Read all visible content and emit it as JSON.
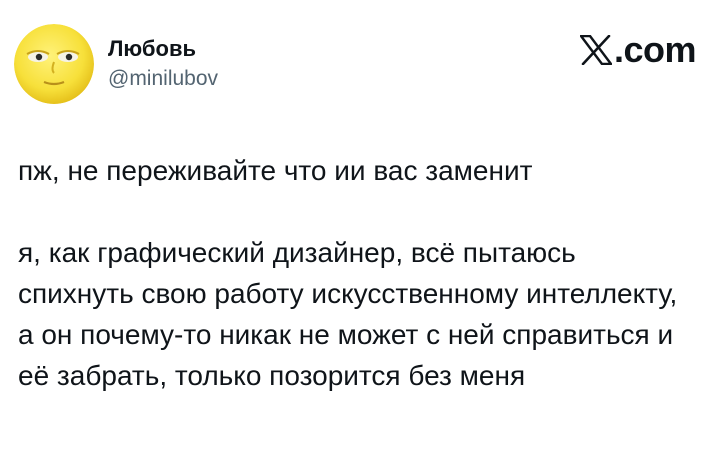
{
  "author": {
    "name": "Любовь",
    "handle": "@minilubov",
    "avatar_icon": "sun-face-emoji-avatar"
  },
  "brand": {
    "icon": "x-logo-icon",
    "label": ".com"
  },
  "tweet": {
    "text": "пж, не переживайте что ии вас заменит\n\nя, как графический дизайнер, всё пытаюсь спихнуть свою работу искусственному интеллекту, а он почему-то никак не может с ней справиться и её забрать, только позорится без меня"
  },
  "colors": {
    "text": "#0f1419",
    "handle": "#536471",
    "avatar_yellow": "#f5e23a"
  }
}
